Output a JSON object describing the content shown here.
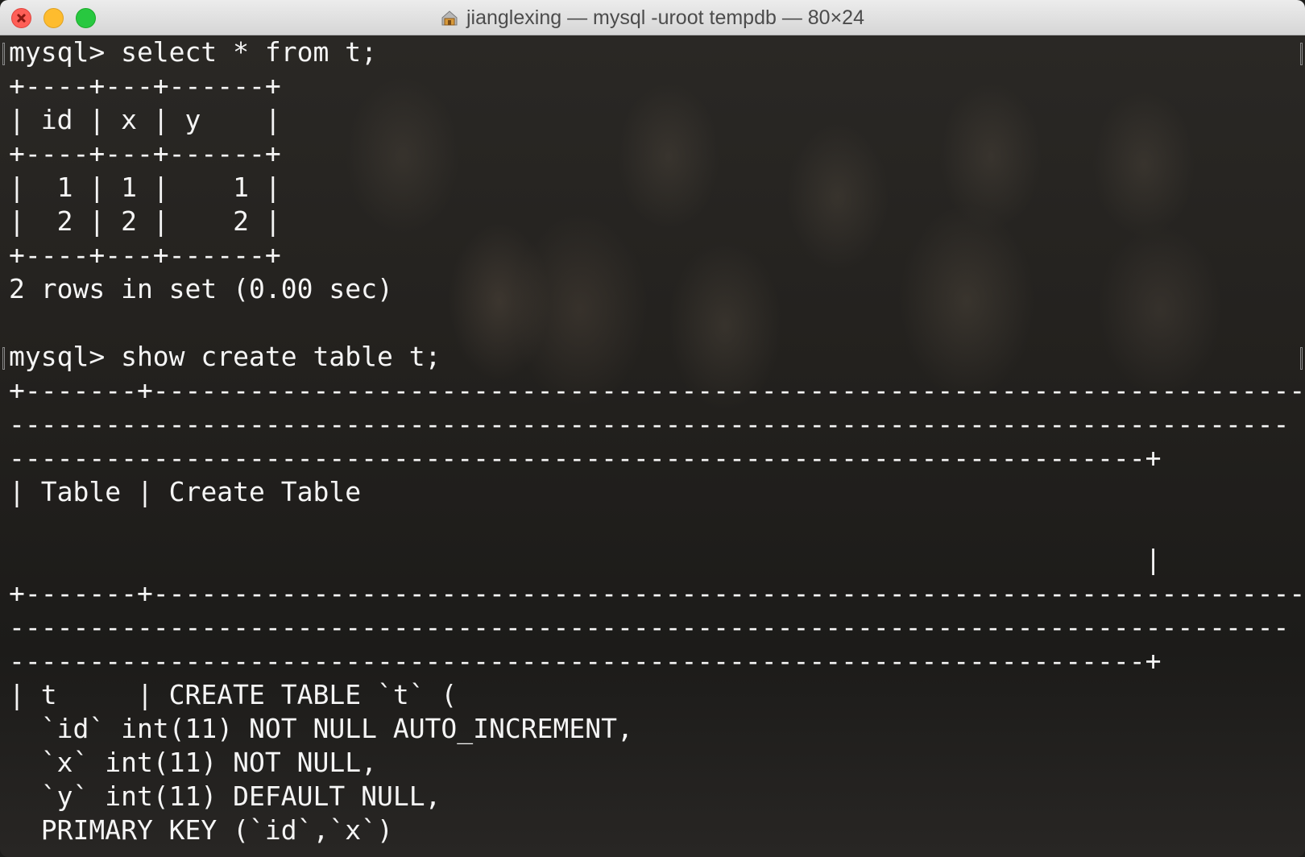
{
  "window": {
    "title": "jianglexing — mysql -uroot tempdb — 80×24",
    "title_icon": "home-folder-icon",
    "controls": [
      "close",
      "minimize",
      "zoom"
    ]
  },
  "terminal": {
    "lines": [
      "mysql> select * from t;",
      "+----+---+------+",
      "| id | x | y    |",
      "+----+---+------+",
      "|  1 | 1 |    1 |",
      "|  2 | 2 |    2 |",
      "+----+---+------+",
      "2 rows in set (0.00 sec)",
      "",
      "mysql> show create table t;",
      "+-------+--------------------------------------------------------------------------",
      "--------------------------------------------------------------------------------",
      "-----------------------------------------------------------------------+",
      "| Table | Create Table",
      "",
      "                                                                       |",
      "+-------+--------------------------------------------------------------------------",
      "--------------------------------------------------------------------------------",
      "-----------------------------------------------------------------------+",
      "| t     | CREATE TABLE `t` (",
      "  `id` int(11) NOT NULL AUTO_INCREMENT,",
      "  `x` int(11) NOT NULL,",
      "  `y` int(11) DEFAULT NULL,",
      "  PRIMARY KEY (`id`,`x`)"
    ]
  },
  "colors": {
    "text": "#f5f5f5",
    "close": "#ff5f57",
    "minimize": "#febc2e",
    "zoom": "#28c840"
  }
}
